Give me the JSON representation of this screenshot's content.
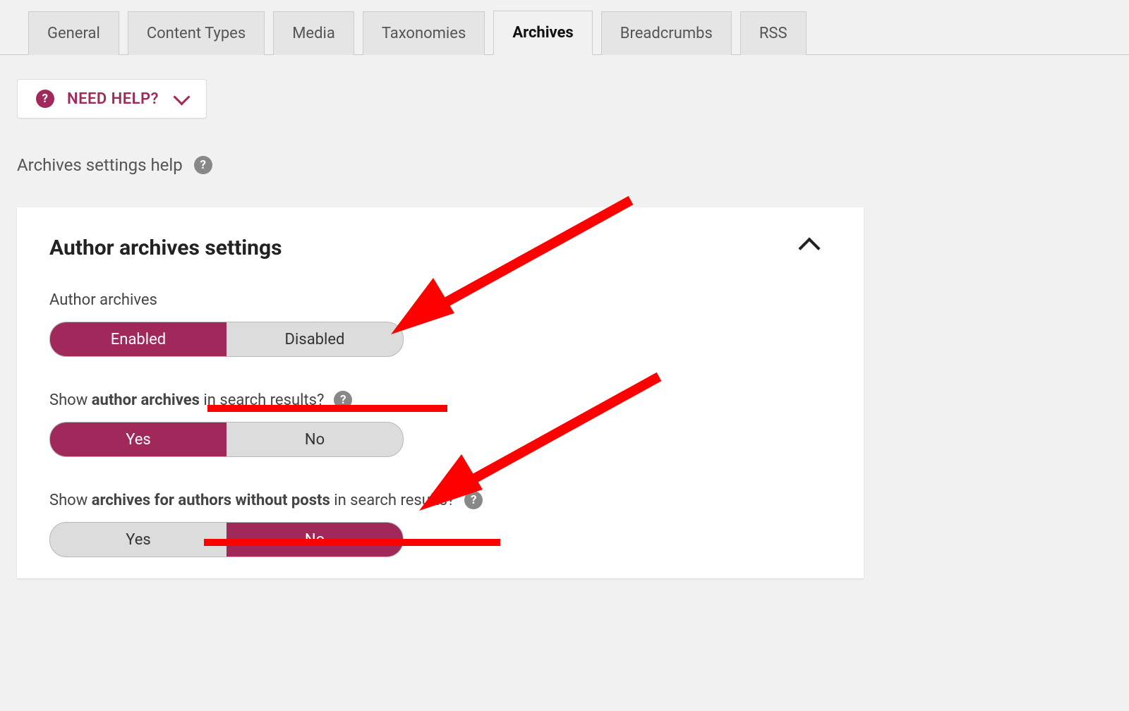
{
  "tabs": {
    "items": [
      {
        "label": "General",
        "active": false
      },
      {
        "label": "Content Types",
        "active": false
      },
      {
        "label": "Media",
        "active": false
      },
      {
        "label": "Taxonomies",
        "active": false
      },
      {
        "label": "Archives",
        "active": true
      },
      {
        "label": "Breadcrumbs",
        "active": false
      },
      {
        "label": "RSS",
        "active": false
      }
    ]
  },
  "need_help": {
    "label": "NEED HELP?"
  },
  "section_help": {
    "label": "Archives settings help"
  },
  "panel": {
    "title": "Author archives settings",
    "field1": {
      "label": "Author archives",
      "opt_on": "Enabled",
      "opt_off": "Disabled",
      "selected": "on"
    },
    "field2": {
      "label_pre": "Show ",
      "label_strong": "author archives",
      "label_post": " in search results?",
      "opt_on": "Yes",
      "opt_off": "No",
      "selected": "on"
    },
    "field3": {
      "label_pre": "Show ",
      "label_strong": "archives for authors without posts",
      "label_post": " in search results?",
      "opt_on": "Yes",
      "opt_off": "No",
      "selected": "off"
    }
  },
  "colors": {
    "accent": "#a0285a",
    "annotation": "#ff0000"
  }
}
